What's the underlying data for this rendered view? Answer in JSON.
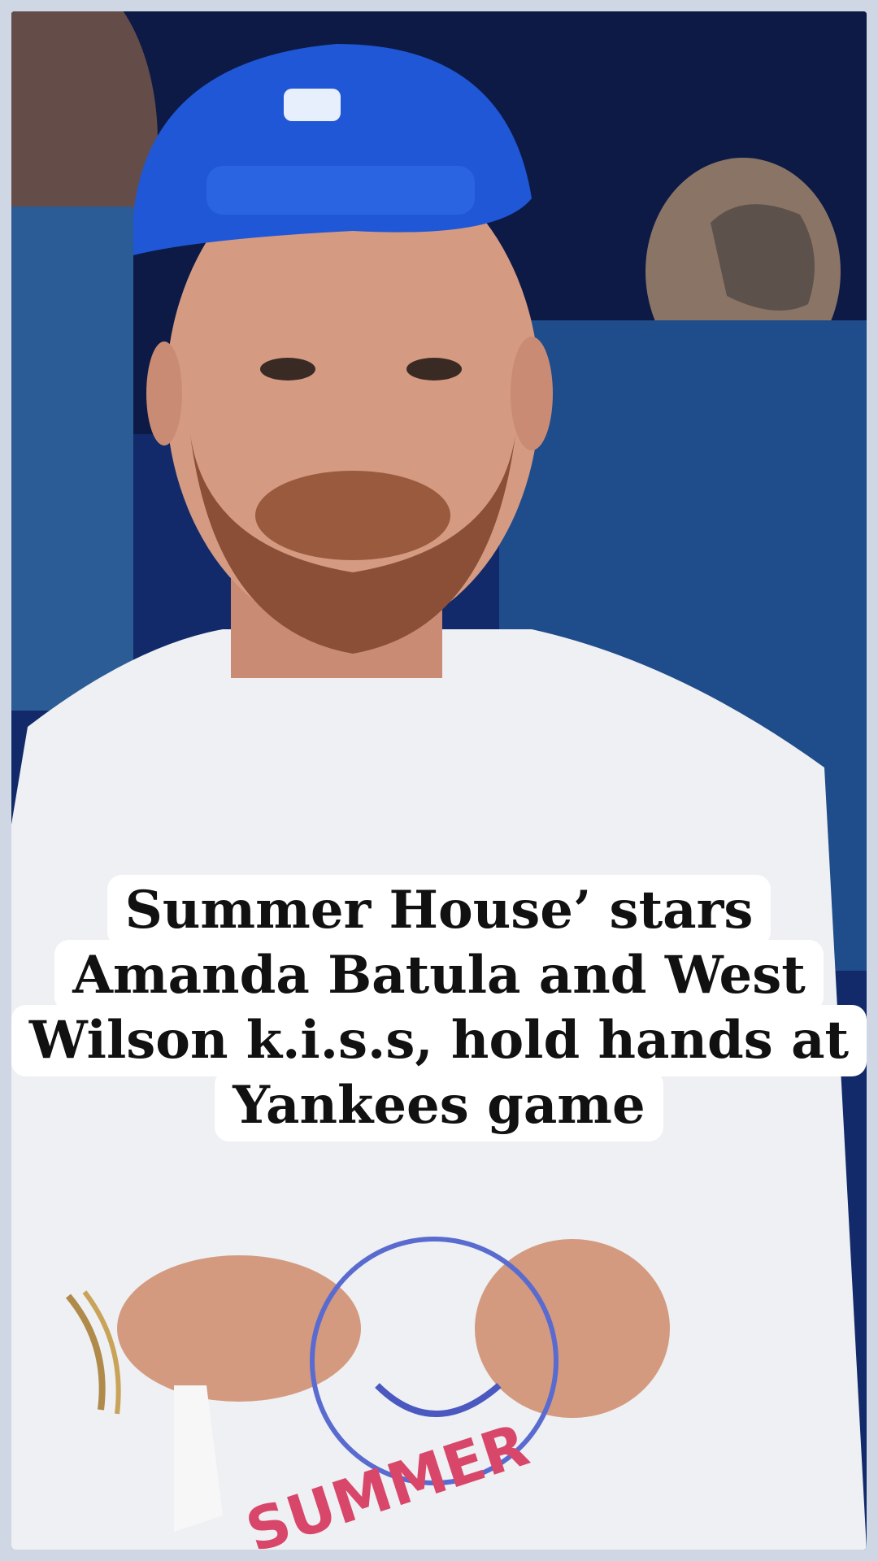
{
  "caption": {
    "lines": [
      "Summer House’ stars",
      "Amanda Batula and West",
      "Wilson k.i.s.s, hold hands at",
      "Yankees game"
    ]
  },
  "photo": {
    "scene": "baseball-stadium-crowd",
    "shirt_print_text": "SUMMER",
    "colors": {
      "cap": "#1f57d6",
      "shirt": "#f1f3f6",
      "background": "#122a6a",
      "print": "#d8466a"
    }
  }
}
